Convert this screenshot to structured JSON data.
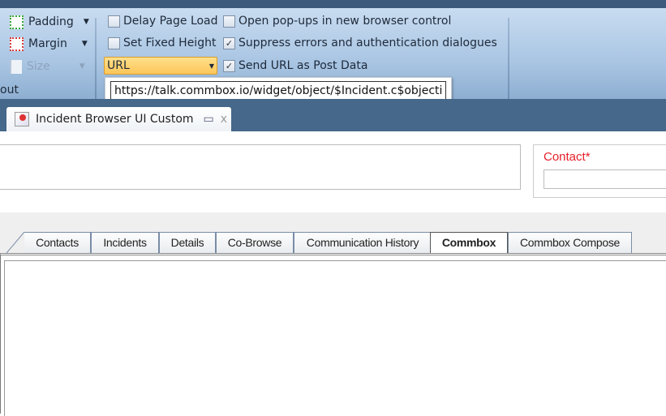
{
  "ribbon": {
    "layout_group": {
      "padding": "Padding",
      "margin": "Margin",
      "size": "Size",
      "group_label": "out"
    },
    "options": [
      {
        "label": "Delay Page Load",
        "checked": false
      },
      {
        "label": "Set Fixed Height",
        "checked": false
      },
      {
        "label": "Open pop-ups in new browser control",
        "checked": false
      },
      {
        "label": "Suppress errors and authentication dialogues",
        "checked": true
      },
      {
        "label": "Send URL as Post Data",
        "checked": true
      }
    ],
    "url_type": "URL",
    "url_value": "https://talk.commbox.io/widget/object/$Incident.c$objectid"
  },
  "document_tab": {
    "title": "Incident Browser UI Custom",
    "restore": "▭",
    "close": "x"
  },
  "form": {
    "contact_label": "Contact*",
    "contact_value": ""
  },
  "tabs": [
    {
      "label": "Contacts",
      "active": false
    },
    {
      "label": "Incidents",
      "active": false
    },
    {
      "label": "Details",
      "active": false
    },
    {
      "label": "Co-Browse",
      "active": false
    },
    {
      "label": "Communication History",
      "active": false
    },
    {
      "label": "Commbox",
      "active": true
    },
    {
      "label": "Commbox Compose",
      "active": false
    }
  ],
  "colors": {
    "ribbon": "#a9c5e3",
    "tabbar": "#46688a",
    "required_label": "#e8202a",
    "combo": "#fcc65a"
  }
}
